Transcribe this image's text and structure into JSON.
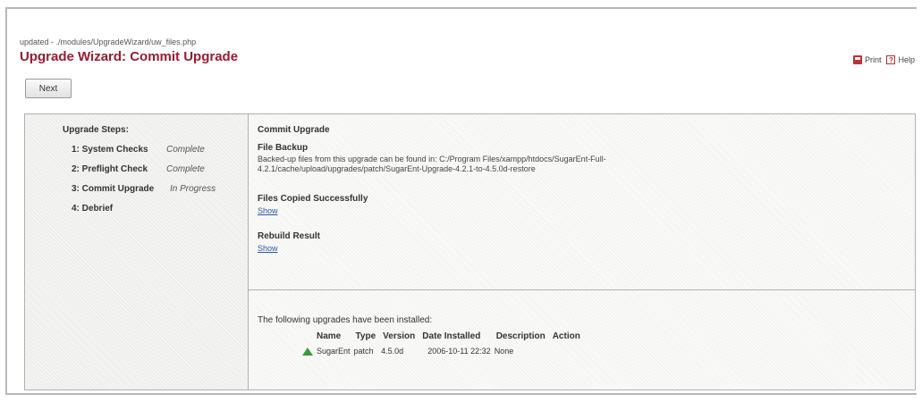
{
  "header": {
    "path": "updated - ./modules/UpgradeWizard/uw_files.php",
    "title": "Upgrade Wizard: Commit Upgrade",
    "print_label": "Print",
    "help_label": "Help"
  },
  "buttons": {
    "next": "Next"
  },
  "steps": {
    "heading": "Upgrade Steps:",
    "items": [
      {
        "label": "1: System Checks",
        "status": "Complete"
      },
      {
        "label": "2: Preflight Check",
        "status": "Complete"
      },
      {
        "label": "3: Commit Upgrade",
        "status": "In Progress"
      },
      {
        "label": "4: Debrief",
        "status": ""
      }
    ]
  },
  "commit": {
    "heading": "Commit Upgrade",
    "backup_heading": "File Backup",
    "backup_text": "Backed-up files from this upgrade can be found in: C:/Program Files/xampp/htdocs/SugarEnt-Full-4.2.1/cache/upload/upgrades/patch/SugarEnt-Upgrade-4.2.1-to-4.5.0d-restore",
    "copied_heading": "Files Copied Successfully",
    "copied_link": "Show",
    "rebuild_heading": "Rebuild Result",
    "rebuild_link": "Show"
  },
  "installed": {
    "intro": "The following upgrades have been installed:",
    "columns": [
      "Name",
      "Type",
      "Version",
      "Date Installed",
      "Description",
      "Action"
    ],
    "rows": [
      {
        "name": "SugarEnt",
        "type": "patch",
        "version": "4.5.0d",
        "date": "2006-10-11 22:32",
        "description": "None",
        "action": ""
      }
    ]
  }
}
